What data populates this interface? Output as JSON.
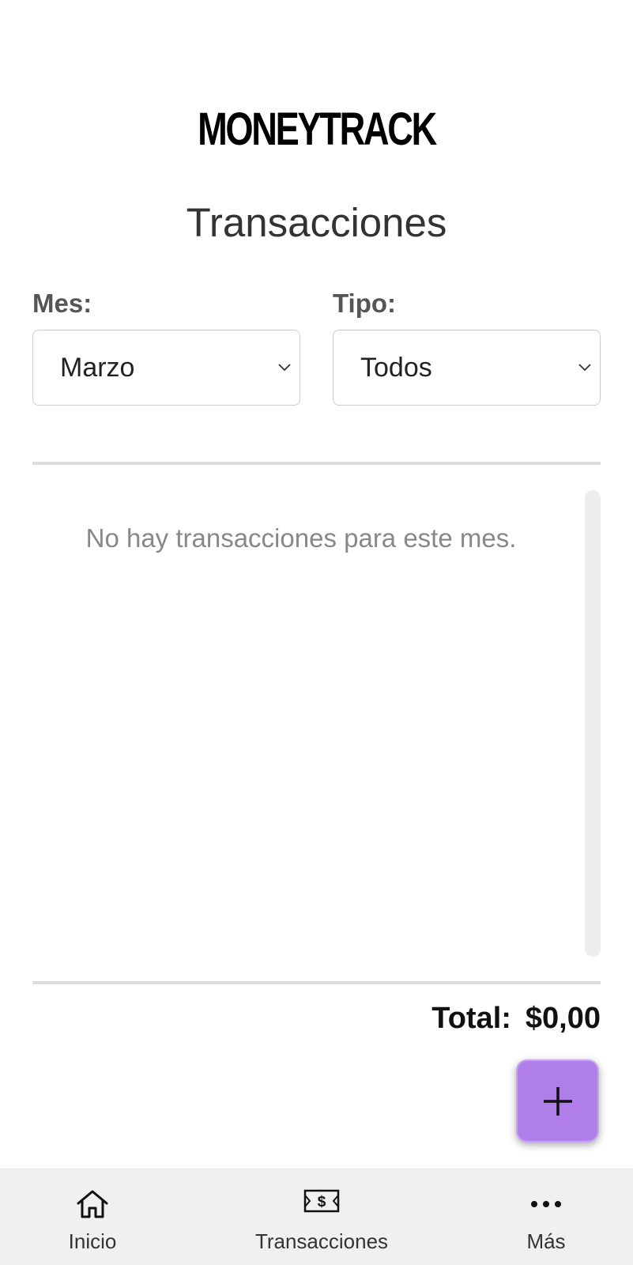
{
  "app": {
    "logo_text": "MONEYTRACK"
  },
  "page": {
    "title": "Transacciones"
  },
  "filters": {
    "month_label": "Mes:",
    "month_value": "Marzo",
    "type_label": "Tipo:",
    "type_value": "Todos"
  },
  "list": {
    "empty_message": "No hay transacciones para este mes."
  },
  "summary": {
    "total_label": "Total:",
    "total_value": "$0,00"
  },
  "fab": {
    "icon": "plus-icon",
    "color": "#b07ee8"
  },
  "bottom_nav": {
    "items": [
      {
        "label": "Inicio",
        "icon": "home-icon"
      },
      {
        "label": "Transacciones",
        "icon": "money-bill-icon"
      },
      {
        "label": "Más",
        "icon": "more-icon"
      }
    ]
  }
}
